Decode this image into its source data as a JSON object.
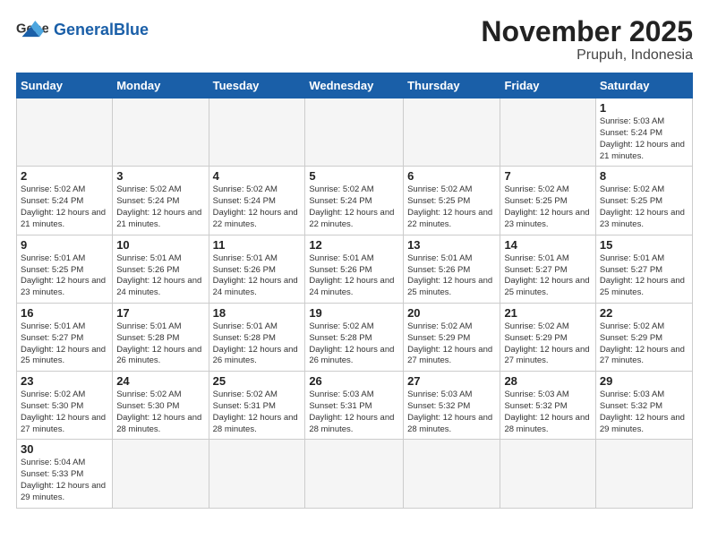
{
  "header": {
    "logo_general": "General",
    "logo_blue": "Blue",
    "month_title": "November 2025",
    "subtitle": "Prupuh, Indonesia"
  },
  "days_of_week": [
    "Sunday",
    "Monday",
    "Tuesday",
    "Wednesday",
    "Thursday",
    "Friday",
    "Saturday"
  ],
  "weeks": [
    [
      {
        "day": "",
        "info": ""
      },
      {
        "day": "",
        "info": ""
      },
      {
        "day": "",
        "info": ""
      },
      {
        "day": "",
        "info": ""
      },
      {
        "day": "",
        "info": ""
      },
      {
        "day": "",
        "info": ""
      },
      {
        "day": "1",
        "info": "Sunrise: 5:03 AM\nSunset: 5:24 PM\nDaylight: 12 hours and 21 minutes."
      }
    ],
    [
      {
        "day": "2",
        "info": "Sunrise: 5:02 AM\nSunset: 5:24 PM\nDaylight: 12 hours and 21 minutes."
      },
      {
        "day": "3",
        "info": "Sunrise: 5:02 AM\nSunset: 5:24 PM\nDaylight: 12 hours and 21 minutes."
      },
      {
        "day": "4",
        "info": "Sunrise: 5:02 AM\nSunset: 5:24 PM\nDaylight: 12 hours and 22 minutes."
      },
      {
        "day": "5",
        "info": "Sunrise: 5:02 AM\nSunset: 5:24 PM\nDaylight: 12 hours and 22 minutes."
      },
      {
        "day": "6",
        "info": "Sunrise: 5:02 AM\nSunset: 5:25 PM\nDaylight: 12 hours and 22 minutes."
      },
      {
        "day": "7",
        "info": "Sunrise: 5:02 AM\nSunset: 5:25 PM\nDaylight: 12 hours and 23 minutes."
      },
      {
        "day": "8",
        "info": "Sunrise: 5:02 AM\nSunset: 5:25 PM\nDaylight: 12 hours and 23 minutes."
      }
    ],
    [
      {
        "day": "9",
        "info": "Sunrise: 5:01 AM\nSunset: 5:25 PM\nDaylight: 12 hours and 23 minutes."
      },
      {
        "day": "10",
        "info": "Sunrise: 5:01 AM\nSunset: 5:26 PM\nDaylight: 12 hours and 24 minutes."
      },
      {
        "day": "11",
        "info": "Sunrise: 5:01 AM\nSunset: 5:26 PM\nDaylight: 12 hours and 24 minutes."
      },
      {
        "day": "12",
        "info": "Sunrise: 5:01 AM\nSunset: 5:26 PM\nDaylight: 12 hours and 24 minutes."
      },
      {
        "day": "13",
        "info": "Sunrise: 5:01 AM\nSunset: 5:26 PM\nDaylight: 12 hours and 25 minutes."
      },
      {
        "day": "14",
        "info": "Sunrise: 5:01 AM\nSunset: 5:27 PM\nDaylight: 12 hours and 25 minutes."
      },
      {
        "day": "15",
        "info": "Sunrise: 5:01 AM\nSunset: 5:27 PM\nDaylight: 12 hours and 25 minutes."
      }
    ],
    [
      {
        "day": "16",
        "info": "Sunrise: 5:01 AM\nSunset: 5:27 PM\nDaylight: 12 hours and 25 minutes."
      },
      {
        "day": "17",
        "info": "Sunrise: 5:01 AM\nSunset: 5:28 PM\nDaylight: 12 hours and 26 minutes."
      },
      {
        "day": "18",
        "info": "Sunrise: 5:01 AM\nSunset: 5:28 PM\nDaylight: 12 hours and 26 minutes."
      },
      {
        "day": "19",
        "info": "Sunrise: 5:02 AM\nSunset: 5:28 PM\nDaylight: 12 hours and 26 minutes."
      },
      {
        "day": "20",
        "info": "Sunrise: 5:02 AM\nSunset: 5:29 PM\nDaylight: 12 hours and 27 minutes."
      },
      {
        "day": "21",
        "info": "Sunrise: 5:02 AM\nSunset: 5:29 PM\nDaylight: 12 hours and 27 minutes."
      },
      {
        "day": "22",
        "info": "Sunrise: 5:02 AM\nSunset: 5:29 PM\nDaylight: 12 hours and 27 minutes."
      }
    ],
    [
      {
        "day": "23",
        "info": "Sunrise: 5:02 AM\nSunset: 5:30 PM\nDaylight: 12 hours and 27 minutes."
      },
      {
        "day": "24",
        "info": "Sunrise: 5:02 AM\nSunset: 5:30 PM\nDaylight: 12 hours and 28 minutes."
      },
      {
        "day": "25",
        "info": "Sunrise: 5:02 AM\nSunset: 5:31 PM\nDaylight: 12 hours and 28 minutes."
      },
      {
        "day": "26",
        "info": "Sunrise: 5:03 AM\nSunset: 5:31 PM\nDaylight: 12 hours and 28 minutes."
      },
      {
        "day": "27",
        "info": "Sunrise: 5:03 AM\nSunset: 5:32 PM\nDaylight: 12 hours and 28 minutes."
      },
      {
        "day": "28",
        "info": "Sunrise: 5:03 AM\nSunset: 5:32 PM\nDaylight: 12 hours and 28 minutes."
      },
      {
        "day": "29",
        "info": "Sunrise: 5:03 AM\nSunset: 5:32 PM\nDaylight: 12 hours and 29 minutes."
      }
    ],
    [
      {
        "day": "30",
        "info": "Sunrise: 5:04 AM\nSunset: 5:33 PM\nDaylight: 12 hours and 29 minutes."
      },
      {
        "day": "",
        "info": ""
      },
      {
        "day": "",
        "info": ""
      },
      {
        "day": "",
        "info": ""
      },
      {
        "day": "",
        "info": ""
      },
      {
        "day": "",
        "info": ""
      },
      {
        "day": "",
        "info": ""
      }
    ]
  ]
}
